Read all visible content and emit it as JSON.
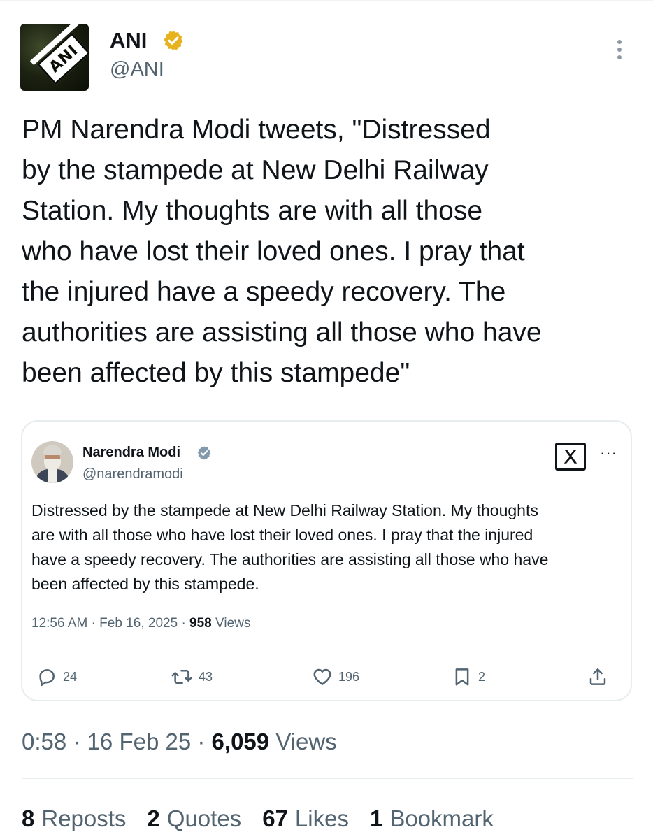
{
  "tweet": {
    "author": {
      "name": "ANI",
      "handle": "@ANI",
      "avatar_text": "ANI",
      "verified_color": "#e6b31e"
    },
    "text": "PM Narendra Modi tweets, \"Distressed\nby the stampede at New Delhi Railway\nStation. My thoughts are with all those\nwho have lost their loved ones. I pray that\nthe injured have a speedy recovery. The\nauthorities are assisting all those who have\nbeen affected by this stampede\"",
    "more_icon": "more-vertical-icon",
    "meta": {
      "time": "0:58",
      "date": "16 Feb 25",
      "views_count": "6,059",
      "views_label": "Views"
    },
    "stats": [
      {
        "count": "8",
        "label": "Reposts"
      },
      {
        "count": "2",
        "label": "Quotes"
      },
      {
        "count": "67",
        "label": "Likes"
      },
      {
        "count": "1",
        "label": "Bookmark"
      }
    ]
  },
  "quote": {
    "author": {
      "name": "Narendra Modi",
      "handle": "@narendramodi",
      "verified_color": "#829aab"
    },
    "text": "Distressed by the stampede at New Delhi Railway Station. My thoughts\nare with all those who have lost their loved ones. I pray that the injured\nhave a speedy recovery. The authorities are assisting all those who have\nbeen affected by this stampede.",
    "meta": {
      "time": "12:56 AM",
      "date": "Feb 16, 2025",
      "views_count": "958",
      "views_label": "Views"
    },
    "actions": {
      "replies": "24",
      "reposts": "43",
      "likes": "196",
      "bookmarks": "2"
    },
    "icons": [
      "reply-icon",
      "repost-icon",
      "like-icon",
      "bookmark-icon",
      "share-icon",
      "x-logo-icon"
    ]
  }
}
